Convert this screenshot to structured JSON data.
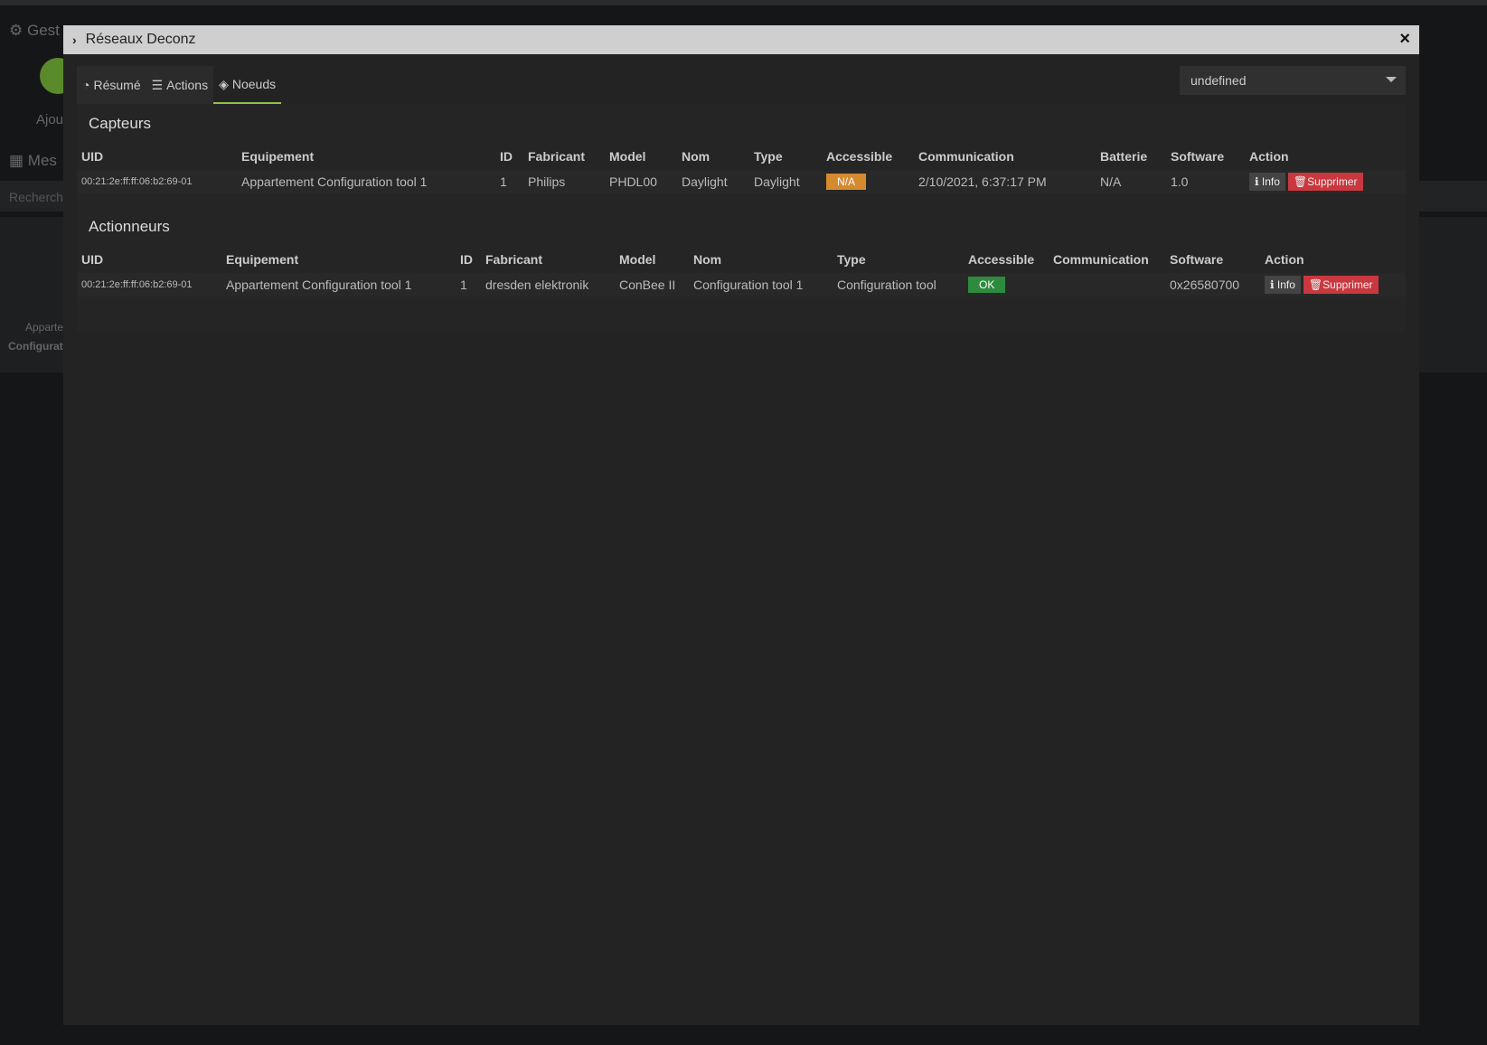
{
  "background": {
    "title": "Gest",
    "add": "Ajou",
    "mine": "Mes",
    "search": "Recherch",
    "card1": "Apparte",
    "card2": "Configurati"
  },
  "modal": {
    "title": "Réseaux Deconz",
    "close": "×"
  },
  "tabs": [
    {
      "label": "Résumé",
      "icon": "dashboard-icon"
    },
    {
      "label": "Actions",
      "icon": "sliders-icon"
    },
    {
      "label": "Noeuds",
      "icon": "codepen-icon"
    }
  ],
  "select": {
    "value": "undefined"
  },
  "sensors": {
    "title": "Capteurs",
    "headers": [
      "UID",
      "Equipement",
      "ID",
      "Fabricant",
      "Model",
      "Nom",
      "Type",
      "Accessible",
      "Communication",
      "Batterie",
      "Software",
      "Action"
    ],
    "rows": [
      {
        "uid": "00:21:2e:ff:ff:06:b2:69-01",
        "equipment": "Appartement Configuration tool 1",
        "id": "1",
        "maker": "Philips",
        "model": "PHDL00",
        "name": "Daylight",
        "type": "Daylight",
        "accessible": "N/A",
        "communication": "2/10/2021, 6:37:17 PM",
        "battery": "N/A",
        "software": "1.0",
        "info": "Info",
        "delete": "Supprimer"
      }
    ]
  },
  "actuators": {
    "title": "Actionneurs",
    "headers": [
      "UID",
      "Equipement",
      "ID",
      "Fabricant",
      "Model",
      "Nom",
      "Type",
      "Accessible",
      "Communication",
      "Software",
      "Action"
    ],
    "rows": [
      {
        "uid": "00:21:2e:ff:ff:06:b2:69-01",
        "equipment": "Appartement Configuration tool 1",
        "id": "1",
        "maker": "dresden elektronik",
        "model": "ConBee II",
        "name": "Configuration tool 1",
        "type": "Configuration tool",
        "accessible": "OK",
        "communication": "",
        "software": "0x26580700",
        "info": "Info",
        "delete": "Supprimer"
      }
    ]
  },
  "colors": {
    "na": "#d68a2e",
    "ok": "#2e8b3e",
    "delete": "#c9383f",
    "active_tab": "#8bc34a"
  }
}
